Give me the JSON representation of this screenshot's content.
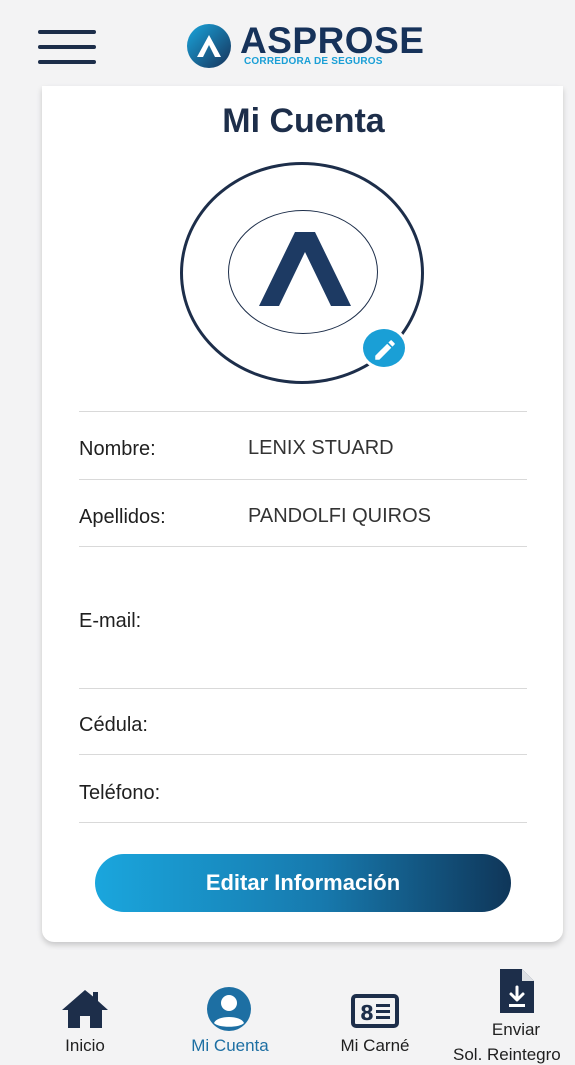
{
  "header": {
    "brand_name": "ASPROSE",
    "brand_tagline": "CORREDORA DE SEGUROS",
    "menu_icon": "hamburger-menu-icon"
  },
  "card": {
    "title": "Mi Cuenta",
    "avatar_icon": "profile-logo-icon",
    "edit_icon": "pencil-icon",
    "fields": [
      {
        "label": "Nombre:",
        "value": "LENIX STUARD"
      },
      {
        "label": "Apellidos:",
        "value": "PANDOLFI QUIROS"
      },
      {
        "label": "E-mail:",
        "value": ""
      },
      {
        "label": "Cédula:",
        "value": ""
      },
      {
        "label": "Teléfono:",
        "value": ""
      }
    ],
    "edit_button": "Editar Información"
  },
  "nav": {
    "active": "Mi Cuenta",
    "items": [
      {
        "label": "Inicio",
        "icon": "home-icon"
      },
      {
        "label": "Mi Cuenta",
        "icon": "user-circle-icon"
      },
      {
        "label": "Mi Carné",
        "icon": "id-card-icon"
      },
      {
        "label": "Enviar",
        "label2": "Sol. Reintegro",
        "icon": "document-download-icon"
      }
    ]
  },
  "colors": {
    "navy": "#1d2e4a",
    "accent": "#1a9fd6",
    "active_nav": "#1d6fa3"
  }
}
